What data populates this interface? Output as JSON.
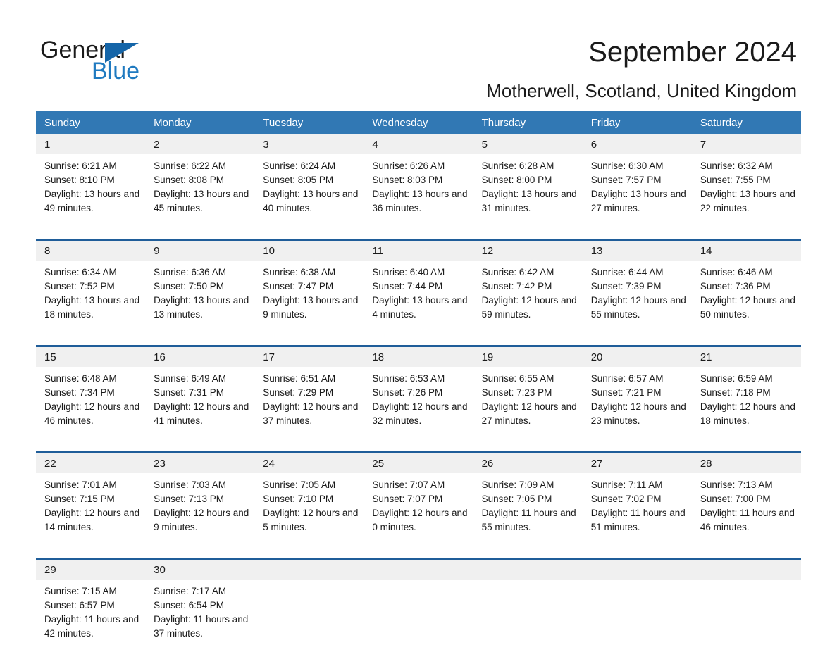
{
  "brand": {
    "name_part1": "General",
    "name_part2": "Blue",
    "triangle_color": "#1565a8",
    "blue_color": "#1f7ac0"
  },
  "header": {
    "title": "September 2024",
    "subtitle": "Motherwell, Scotland, United Kingdom"
  },
  "colors": {
    "header_row_bg": "#3178b4",
    "date_band_bg": "#f0f0f0",
    "week_divider": "#1f5d99",
    "page_bg": "#ffffff",
    "text": "#1a1a1a"
  },
  "calendar": {
    "weekday_headers": [
      "Sunday",
      "Monday",
      "Tuesday",
      "Wednesday",
      "Thursday",
      "Friday",
      "Saturday"
    ],
    "weeks": [
      {
        "dates": [
          "1",
          "2",
          "3",
          "4",
          "5",
          "6",
          "7"
        ],
        "cells": [
          {
            "sunrise": "Sunrise: 6:21 AM",
            "sunset": "Sunset: 8:10 PM",
            "daylight": "Daylight: 13 hours and 49 minutes."
          },
          {
            "sunrise": "Sunrise: 6:22 AM",
            "sunset": "Sunset: 8:08 PM",
            "daylight": "Daylight: 13 hours and 45 minutes."
          },
          {
            "sunrise": "Sunrise: 6:24 AM",
            "sunset": "Sunset: 8:05 PM",
            "daylight": "Daylight: 13 hours and 40 minutes."
          },
          {
            "sunrise": "Sunrise: 6:26 AM",
            "sunset": "Sunset: 8:03 PM",
            "daylight": "Daylight: 13 hours and 36 minutes."
          },
          {
            "sunrise": "Sunrise: 6:28 AM",
            "sunset": "Sunset: 8:00 PM",
            "daylight": "Daylight: 13 hours and 31 minutes."
          },
          {
            "sunrise": "Sunrise: 6:30 AM",
            "sunset": "Sunset: 7:57 PM",
            "daylight": "Daylight: 13 hours and 27 minutes."
          },
          {
            "sunrise": "Sunrise: 6:32 AM",
            "sunset": "Sunset: 7:55 PM",
            "daylight": "Daylight: 13 hours and 22 minutes."
          }
        ]
      },
      {
        "dates": [
          "8",
          "9",
          "10",
          "11",
          "12",
          "13",
          "14"
        ],
        "cells": [
          {
            "sunrise": "Sunrise: 6:34 AM",
            "sunset": "Sunset: 7:52 PM",
            "daylight": "Daylight: 13 hours and 18 minutes."
          },
          {
            "sunrise": "Sunrise: 6:36 AM",
            "sunset": "Sunset: 7:50 PM",
            "daylight": "Daylight: 13 hours and 13 minutes."
          },
          {
            "sunrise": "Sunrise: 6:38 AM",
            "sunset": "Sunset: 7:47 PM",
            "daylight": "Daylight: 13 hours and 9 minutes."
          },
          {
            "sunrise": "Sunrise: 6:40 AM",
            "sunset": "Sunset: 7:44 PM",
            "daylight": "Daylight: 13 hours and 4 minutes."
          },
          {
            "sunrise": "Sunrise: 6:42 AM",
            "sunset": "Sunset: 7:42 PM",
            "daylight": "Daylight: 12 hours and 59 minutes."
          },
          {
            "sunrise": "Sunrise: 6:44 AM",
            "sunset": "Sunset: 7:39 PM",
            "daylight": "Daylight: 12 hours and 55 minutes."
          },
          {
            "sunrise": "Sunrise: 6:46 AM",
            "sunset": "Sunset: 7:36 PM",
            "daylight": "Daylight: 12 hours and 50 minutes."
          }
        ]
      },
      {
        "dates": [
          "15",
          "16",
          "17",
          "18",
          "19",
          "20",
          "21"
        ],
        "cells": [
          {
            "sunrise": "Sunrise: 6:48 AM",
            "sunset": "Sunset: 7:34 PM",
            "daylight": "Daylight: 12 hours and 46 minutes."
          },
          {
            "sunrise": "Sunrise: 6:49 AM",
            "sunset": "Sunset: 7:31 PM",
            "daylight": "Daylight: 12 hours and 41 minutes."
          },
          {
            "sunrise": "Sunrise: 6:51 AM",
            "sunset": "Sunset: 7:29 PM",
            "daylight": "Daylight: 12 hours and 37 minutes."
          },
          {
            "sunrise": "Sunrise: 6:53 AM",
            "sunset": "Sunset: 7:26 PM",
            "daylight": "Daylight: 12 hours and 32 minutes."
          },
          {
            "sunrise": "Sunrise: 6:55 AM",
            "sunset": "Sunset: 7:23 PM",
            "daylight": "Daylight: 12 hours and 27 minutes."
          },
          {
            "sunrise": "Sunrise: 6:57 AM",
            "sunset": "Sunset: 7:21 PM",
            "daylight": "Daylight: 12 hours and 23 minutes."
          },
          {
            "sunrise": "Sunrise: 6:59 AM",
            "sunset": "Sunset: 7:18 PM",
            "daylight": "Daylight: 12 hours and 18 minutes."
          }
        ]
      },
      {
        "dates": [
          "22",
          "23",
          "24",
          "25",
          "26",
          "27",
          "28"
        ],
        "cells": [
          {
            "sunrise": "Sunrise: 7:01 AM",
            "sunset": "Sunset: 7:15 PM",
            "daylight": "Daylight: 12 hours and 14 minutes."
          },
          {
            "sunrise": "Sunrise: 7:03 AM",
            "sunset": "Sunset: 7:13 PM",
            "daylight": "Daylight: 12 hours and 9 minutes."
          },
          {
            "sunrise": "Sunrise: 7:05 AM",
            "sunset": "Sunset: 7:10 PM",
            "daylight": "Daylight: 12 hours and 5 minutes."
          },
          {
            "sunrise": "Sunrise: 7:07 AM",
            "sunset": "Sunset: 7:07 PM",
            "daylight": "Daylight: 12 hours and 0 minutes."
          },
          {
            "sunrise": "Sunrise: 7:09 AM",
            "sunset": "Sunset: 7:05 PM",
            "daylight": "Daylight: 11 hours and 55 minutes."
          },
          {
            "sunrise": "Sunrise: 7:11 AM",
            "sunset": "Sunset: 7:02 PM",
            "daylight": "Daylight: 11 hours and 51 minutes."
          },
          {
            "sunrise": "Sunrise: 7:13 AM",
            "sunset": "Sunset: 7:00 PM",
            "daylight": "Daylight: 11 hours and 46 minutes."
          }
        ]
      },
      {
        "dates": [
          "29",
          "30",
          "",
          "",
          "",
          "",
          ""
        ],
        "cells": [
          {
            "sunrise": "Sunrise: 7:15 AM",
            "sunset": "Sunset: 6:57 PM",
            "daylight": "Daylight: 11 hours and 42 minutes."
          },
          {
            "sunrise": "Sunrise: 7:17 AM",
            "sunset": "Sunset: 6:54 PM",
            "daylight": "Daylight: 11 hours and 37 minutes."
          },
          {
            "sunrise": "",
            "sunset": "",
            "daylight": ""
          },
          {
            "sunrise": "",
            "sunset": "",
            "daylight": ""
          },
          {
            "sunrise": "",
            "sunset": "",
            "daylight": ""
          },
          {
            "sunrise": "",
            "sunset": "",
            "daylight": ""
          },
          {
            "sunrise": "",
            "sunset": "",
            "daylight": ""
          }
        ]
      }
    ]
  }
}
